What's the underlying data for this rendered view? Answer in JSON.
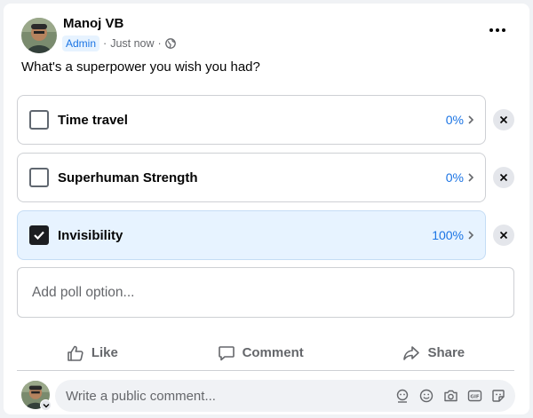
{
  "post": {
    "author": "Manoj VB",
    "badge": "Admin",
    "time": "Just now",
    "separator": "·",
    "audience_icon": "globe-icon",
    "question": "What's a superpower you wish you had?"
  },
  "poll": {
    "options": [
      {
        "label": "Time travel",
        "percent": "0%",
        "checked": false
      },
      {
        "label": "Superhuman Strength",
        "percent": "0%",
        "checked": false
      },
      {
        "label": "Invisibility",
        "percent": "100%",
        "checked": true
      }
    ],
    "add_placeholder": "Add poll option..."
  },
  "actions": {
    "like": "Like",
    "comment": "Comment",
    "share": "Share"
  },
  "comment": {
    "placeholder": "Write a public comment...",
    "icons": [
      "avatar-sticker-icon",
      "emoji-icon",
      "camera-icon",
      "gif-icon",
      "sticker-icon"
    ]
  },
  "colors": {
    "accent": "#1b74e4",
    "selected_bg": "#e7f3ff",
    "secondary_text": "#65676b"
  }
}
